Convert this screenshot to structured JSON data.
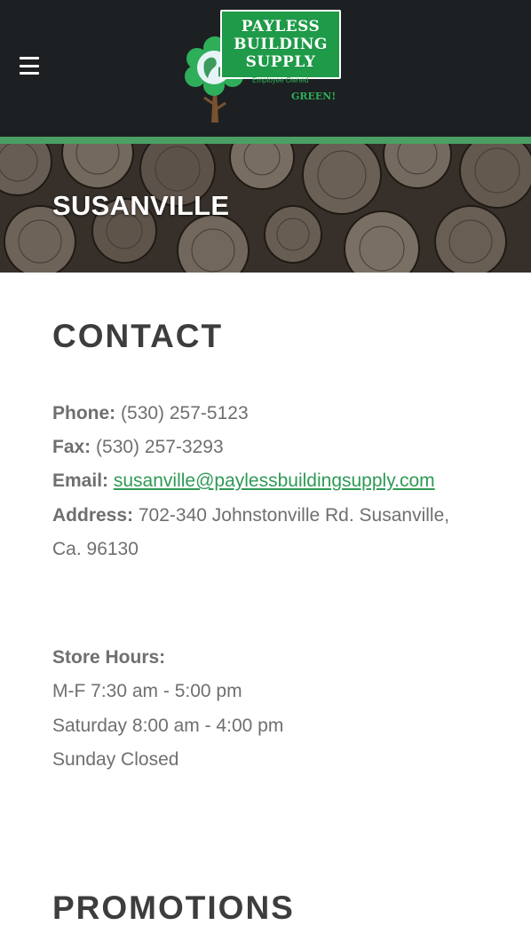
{
  "header": {
    "menu_icon": "hamburger-menu-icon",
    "logo": {
      "line1": "PAYLESS",
      "line2": "BUILDING",
      "line3": "SUPPLY",
      "tagline": "Employee Owned",
      "green": "GREEN!"
    }
  },
  "hero": {
    "title": "SUSANVILLE"
  },
  "contact": {
    "heading": "CONTACT",
    "phone_label": "Phone:",
    "phone": "(530) 257-5123",
    "fax_label": "Fax:",
    "fax": "(530) 257-3293",
    "email_label": "Email:",
    "email": "susanville@paylessbuildingsupply.com",
    "address_label": "Address:",
    "address_line1": "702-340 Johnstonville Rd. Susanville,",
    "address_line2": "Ca. 96130"
  },
  "hours": {
    "label": "Store Hours:",
    "weekday": "M-F 7:30 am - 5:00 pm",
    "saturday": "Saturday 8:00 am - 4:00 pm",
    "sunday": "Sunday Closed"
  },
  "promotions": {
    "heading": "PROMOTIONS"
  },
  "colors": {
    "header_bg": "#1c2022",
    "accent": "#4c9f63",
    "link": "#2e9a55",
    "logo_green": "#1e9a48"
  }
}
